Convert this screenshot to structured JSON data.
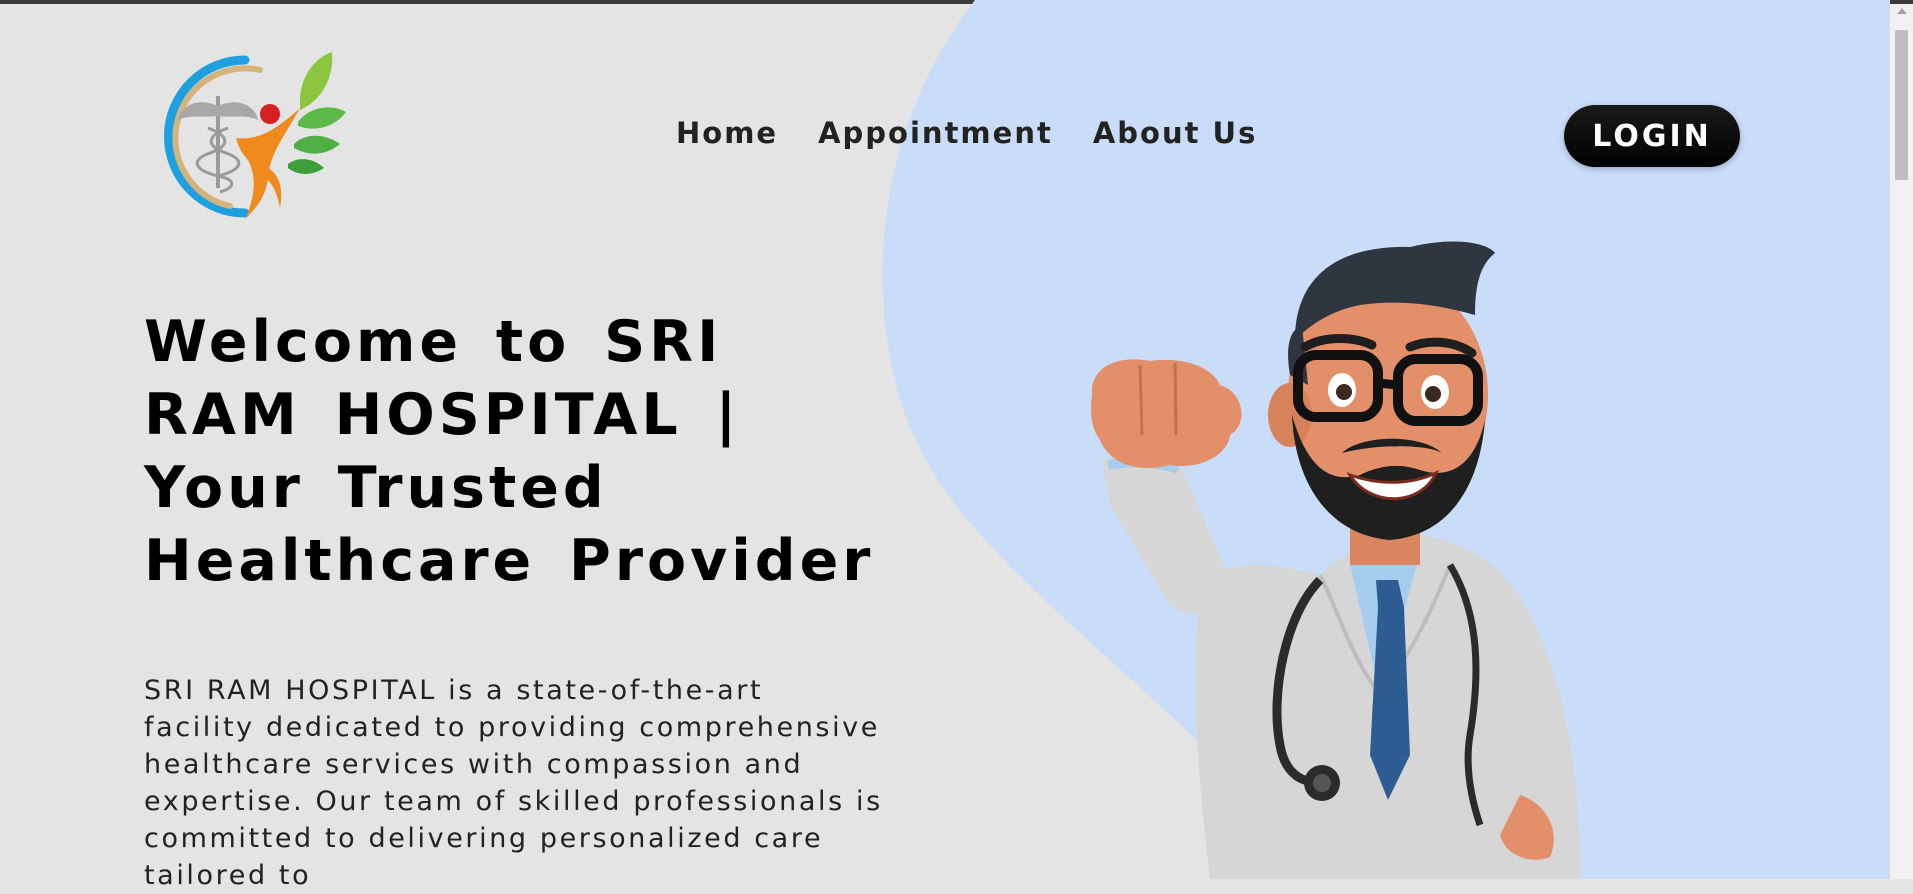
{
  "nav": {
    "items": [
      {
        "label": "Home"
      },
      {
        "label": "Appointment"
      },
      {
        "label": "About Us"
      }
    ]
  },
  "header": {
    "login_label": "LOGIN"
  },
  "hero": {
    "title": "Welcome to SRI RAM HOSPITAL | Your Trusted Healthcare Provider",
    "description": "SRI RAM HOSPITAL is a state-of-the-art facility dedicated to providing comprehensive healthcare services with compassion and expertise. Our team of skilled professionals is committed to delivering personalized care tailored to"
  },
  "colors": {
    "background": "#e4e4e4",
    "accent_blob": "#c9dcf8",
    "button": "#111111"
  },
  "icons": {
    "logo": "caduceus-person-leaves-logo",
    "illustration": "cartoon-doctor-illustration"
  }
}
